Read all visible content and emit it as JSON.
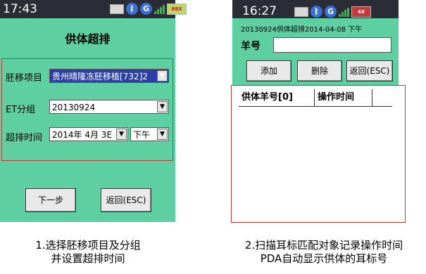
{
  "screen1": {
    "time": "17:43",
    "battery": "88X",
    "title": "供体超排",
    "fields": {
      "project_label": "胚移项目",
      "project_value": "贵州晴隆冻胚移植[732]2",
      "group_label": "ET分组",
      "group_value": "20130924",
      "time_label": "超排时间",
      "date_value": "2014年  4月  3E",
      "ampm_value": "下午"
    },
    "next_label": "下一步",
    "back_label": "返回(ESC)"
  },
  "screen2": {
    "time": "16:27",
    "battery": "4X",
    "subtitle": "20130924供体超排2014-04-08 下午",
    "sheep_label": "羊号",
    "sheep_value": "",
    "buttons": {
      "add": "添加",
      "delete": "删除",
      "back": "返回(ESC)"
    },
    "table": {
      "col1": "供体羊号[0]",
      "col2": "操作时间"
    }
  },
  "captions": {
    "left_line1": "1.选择胚移项目及分组",
    "left_line2": "并设置超排时间",
    "right_line1": "2.扫描耳标匹配对象记录操作时间",
    "right_line2": "PDA自动显示供体的耳标号"
  },
  "colors": {
    "screen_bg": "#5dcfa0",
    "statusbar": "#2b2d36",
    "highlight_frame": "#c43a3a",
    "selection": "#2c3fa6"
  },
  "icons": [
    "keyboard-icon",
    "bluetooth-icon",
    "gprs-icon",
    "signal-icon",
    "battery-icon"
  ]
}
